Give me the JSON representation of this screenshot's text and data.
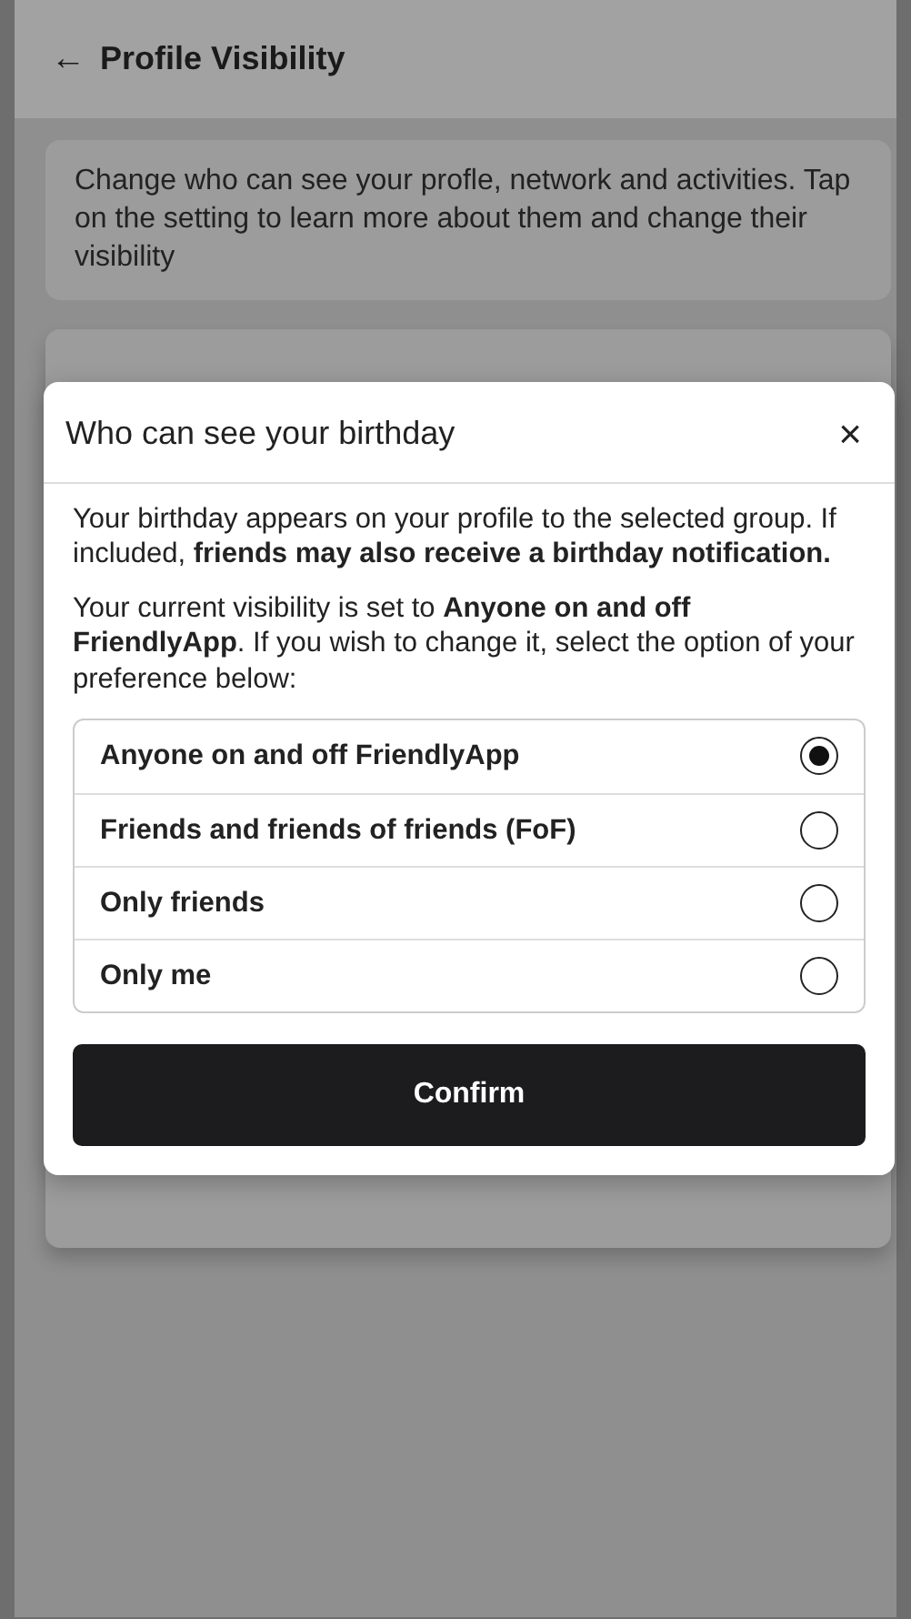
{
  "header": {
    "back_icon": "←",
    "title": "Profile Visibility"
  },
  "intro": "Change who can see your profle, network and activities. Tap on the setting to learn more about them and change their visibility",
  "dialog": {
    "title": "Who can see your birthday",
    "close": "×",
    "paragraphs": [
      "Your birthday appears on your profile to the selected group. If included, **friends may also receive a birthday notification.**",
      "Your current visibility is set to **Anyone on and off FriendlyApp**. If you wish to change it, select the option of your preference below:"
    ],
    "options": [
      {
        "label": "Anyone on and off FriendlyApp",
        "selected": true
      },
      {
        "label": "Friends and friends of friends (FoF)",
        "selected": false
      },
      {
        "label": "Only friends",
        "selected": false
      },
      {
        "label": "Only me",
        "selected": false
      }
    ],
    "button": "Confirm"
  }
}
